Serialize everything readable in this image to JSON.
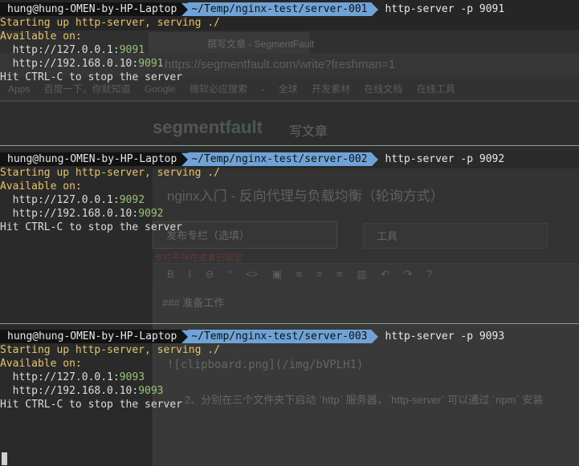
{
  "background_browser": {
    "tab_label": "撰写文章 - SegmentFault",
    "url": "https://segmentfault.com/write?freshman=1",
    "bookmarks": "Apps 百度一下，你就知道 Google 微软必应搜索 - 全球 开发素材 在线文档 在线工具",
    "logo_a": "segment",
    "logo_b": "fault",
    "write_label": "写文章",
    "article_title": "nginx入门 - 反向代理与负载均衡（轮询方式）",
    "column_select": "发布专栏（选填）",
    "tag_select": "工具",
    "error_text": "专栏不存在或者已锁定",
    "toolbar": "B I ⊖ “ <> ▣ ≡ ≡ ≡ ▥ ↶ ↷ ?",
    "editor_line1": "### 准备工作",
    "editor_line2": "![clipboard.png](/img/bVPLH1)",
    "editor_line3": "2、分别在三个文件夹下启动 `http` 服务器，`http-server` 可以通过 `npm` 安装"
  },
  "colors": {
    "path_segment": "#6fa3d8",
    "user_segment": "#121212",
    "status_yellow": "#e8c36d",
    "port_green": "#98c379"
  },
  "panes": [
    {
      "user": "hung@hung-OMEN-by-HP-Laptop",
      "path": "~/Temp/nginx-test/server-001",
      "command": "http-server -p 9091",
      "starting": "Starting up http-server, serving ./",
      "available": "Available on:",
      "url1_host": "  http://127.0.0.1:",
      "url1_port": "9091",
      "url2_host": "  http://192.168.0.10:",
      "url2_port": "9091",
      "hint": "Hit CTRL-C to stop the server"
    },
    {
      "user": "hung@hung-OMEN-by-HP-Laptop",
      "path": "~/Temp/nginx-test/server-002",
      "command": "http-server -p 9092",
      "starting": "Starting up http-server, serving ./",
      "available": "Available on:",
      "url1_host": "  http://127.0.0.1:",
      "url1_port": "9092",
      "url2_host": "  http://192.168.0.10:",
      "url2_port": "9092",
      "hint": "Hit CTRL-C to stop the server"
    },
    {
      "user": "hung@hung-OMEN-by-HP-Laptop",
      "path": "~/Temp/nginx-test/server-003",
      "command": "http-server -p 9093",
      "starting": "Starting up http-server, serving ./",
      "available": "Available on:",
      "url1_host": "  http://127.0.0.1:",
      "url1_port": "9093",
      "url2_host": "  http://192.168.0.10:",
      "url2_port": "9093",
      "hint": "Hit CTRL-C to stop the server"
    }
  ]
}
